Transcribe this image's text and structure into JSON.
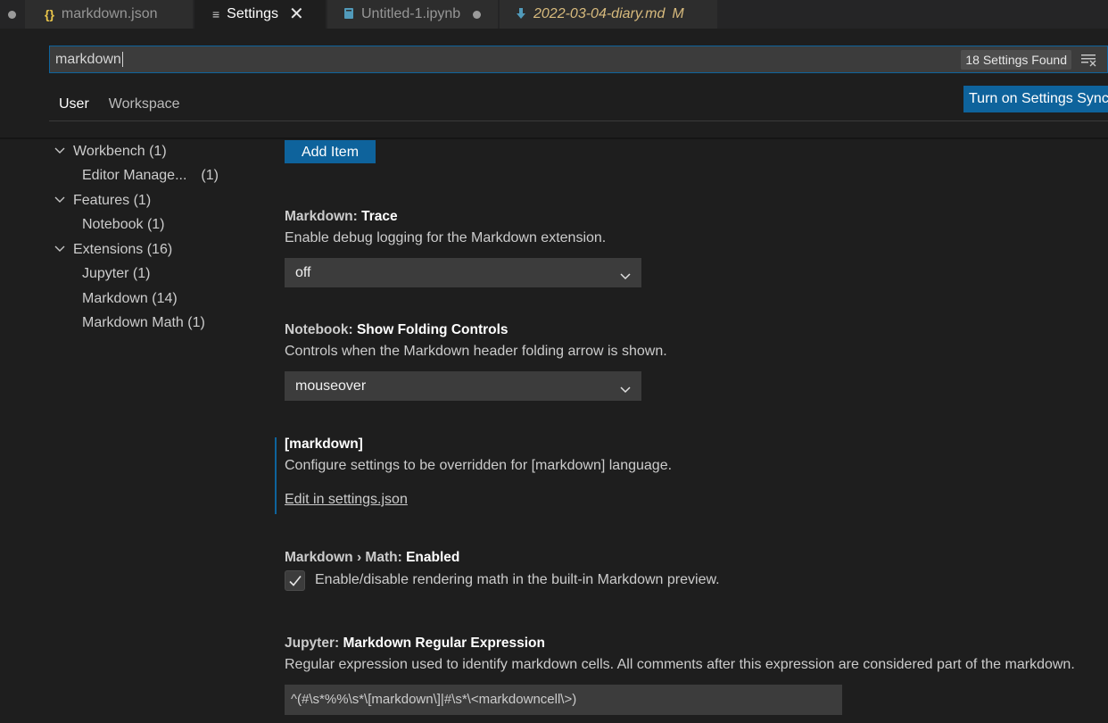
{
  "tabs": [
    {
      "label": "markdown.json",
      "icon": "{}",
      "state": "dirty"
    },
    {
      "label": "Settings",
      "icon": "≡",
      "state": "active"
    },
    {
      "label": "Untitled-1.ipynb",
      "icon": "notebook",
      "state": "dirty"
    },
    {
      "label": "2022-03-04-diary.md",
      "icon": "markdown-download",
      "flag": "M"
    }
  ],
  "search": {
    "value": "markdown",
    "result_count": "18 Settings Found"
  },
  "scope": {
    "user": "User",
    "workspace": "Workspace"
  },
  "sync_button": "Turn on Settings Sync",
  "toc": [
    {
      "label": "Workbench",
      "count": "(1)",
      "expanded": true
    },
    {
      "label": "Editor Manage...",
      "count": "(1)"
    },
    {
      "label": "Features",
      "count": "(1)",
      "expanded": true
    },
    {
      "label": "Notebook",
      "count": "(1)"
    },
    {
      "label": "Extensions",
      "count": "(16)",
      "expanded": true
    },
    {
      "label": "Jupyter",
      "count": "(1)"
    },
    {
      "label": "Markdown",
      "count": "(14)"
    },
    {
      "label": "Markdown Math",
      "count": "(1)"
    }
  ],
  "add_item_label": "Add Item",
  "settings": {
    "trace": {
      "category": "Markdown: ",
      "name": "Trace",
      "description": "Enable debug logging for the Markdown extension.",
      "value": "off"
    },
    "folding": {
      "category": "Notebook: ",
      "name": "Show Folding Controls",
      "description": "Controls when the Markdown header folding arrow is shown.",
      "value": "mouseover"
    },
    "language": {
      "name": "[markdown]",
      "description": "Configure settings to be overridden for [markdown] language.",
      "link": "Edit in settings.json"
    },
    "math": {
      "category": "Markdown › Math: ",
      "name": "Enabled",
      "checkbox_label": "Enable/disable rendering math in the built-in Markdown preview.",
      "checked": true
    },
    "jupyter": {
      "category": "Jupyter: ",
      "name": "Markdown Regular Expression",
      "description": "Regular expression used to identify markdown cells. All comments after this expression are considered part of the markdown.",
      "value": "^(#\\s*%%\\s*\\[markdown\\]|#\\s*\\<markdowncell\\>)"
    }
  },
  "colors": {
    "accent": "#0e639c",
    "background": "#1e1e1e",
    "input": "#3c3c3c"
  }
}
